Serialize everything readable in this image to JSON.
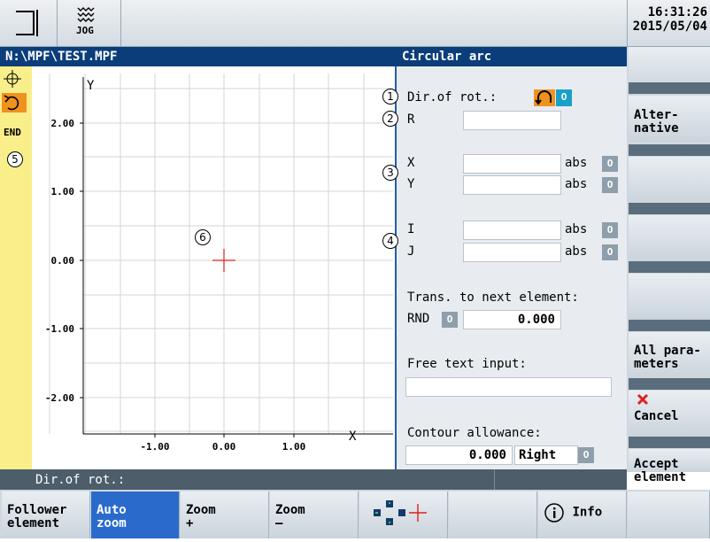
{
  "header": {
    "mode_label": "JOG",
    "time": "16:31:26",
    "date": "2015/05/04"
  },
  "titlebar": {
    "path": "N:\\MPF\\TEST.MPF",
    "dialog_title": "Circular arc"
  },
  "left_strip": {
    "end_label": "END",
    "callout": "5"
  },
  "graph": {
    "y_axis_label": "Y",
    "x_axis_label": "X",
    "y_ticks": [
      "2.00",
      "1.00",
      "0.00",
      "-1.00",
      "-2.00"
    ],
    "x_ticks": [
      "-1.00",
      "0.00",
      "1.00"
    ],
    "callout": "6"
  },
  "form": {
    "callouts": [
      "1",
      "2",
      "3",
      "4"
    ],
    "dir_rot_label": "Dir.of rot.:",
    "r_label": "R",
    "x_label": "X",
    "y_label": "Y",
    "i_label": "I",
    "j_label": "J",
    "abs": "abs",
    "trans_label": "Trans. to next element:",
    "rnd_label": "RND",
    "rnd_value": "0.000",
    "free_text_label": "Free text input:",
    "contour_label": "Contour allowance:",
    "contour_value": "0.000",
    "contour_side": "Right",
    "toggle_glyph": "O",
    "accent_color": "#f0921e",
    "toggle_color": "#1aa0c8"
  },
  "status": {
    "text": "Dir.of rot.:"
  },
  "vertical_softkeys": {
    "alternative": [
      "Alter-",
      "native"
    ],
    "all_parameters": [
      "All para-",
      "meters"
    ],
    "cancel": "Cancel",
    "accept": [
      "Accept",
      "element"
    ]
  },
  "horizontal_softkeys": {
    "follower": [
      "Follower",
      "element"
    ],
    "auto_zoom": [
      "Auto",
      "zoom"
    ],
    "zoom_plus": [
      "Zoom",
      "+"
    ],
    "zoom_minus": [
      "Zoom",
      "–"
    ],
    "info": "Info"
  }
}
